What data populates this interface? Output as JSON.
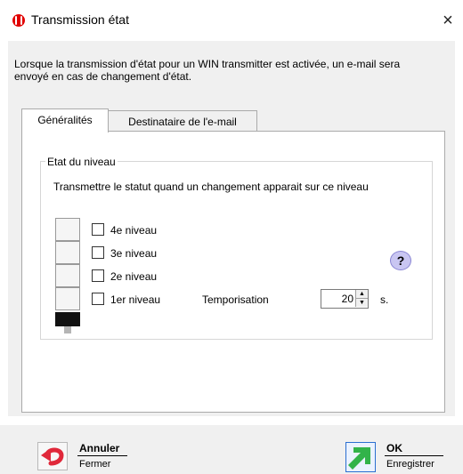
{
  "window": {
    "title": "Transmission état",
    "close_symbol": "×"
  },
  "description": "Lorsque la transmission d'état pour un WIN transmitter est activée, un e-mail sera envoyé en cas de changement d'état.",
  "tabs": [
    {
      "label": "Généralités",
      "active": true
    },
    {
      "label": "Destinataire de l'e-mail",
      "active": false
    }
  ],
  "group": {
    "legend": "Etat du niveau",
    "instruction": "Transmettre le statut quand un changement apparait sur ce niveau",
    "levels": [
      {
        "label": "4e niveau",
        "checked": false
      },
      {
        "label": "3e niveau",
        "checked": false
      },
      {
        "label": "2e niveau",
        "checked": false
      },
      {
        "label": "1er niveau",
        "checked": false
      }
    ],
    "delay": {
      "label": "Temporisation",
      "value": "20",
      "unit": "s."
    },
    "help_symbol": "?"
  },
  "footer": {
    "cancel": {
      "title": "Annuler",
      "subtitle": "Fermer"
    },
    "ok": {
      "title": "OK",
      "subtitle": "Enregistrer"
    }
  },
  "colors": {
    "app_icon": "#e10000",
    "cancel_arrow": "#e0283a",
    "ok_arrow": "#32b34a",
    "help_icon": "#c9c6f2",
    "dialog_background": "#f0f0f0"
  }
}
